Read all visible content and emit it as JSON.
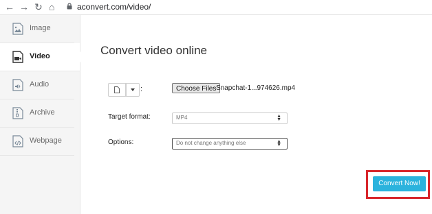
{
  "browser": {
    "url": "aconvert.com/video/",
    "back_glyph": "←",
    "forward_glyph": "→",
    "reload_glyph": "↻",
    "home_glyph": "⌂"
  },
  "sidebar": {
    "items": [
      {
        "label": "Image",
        "icon": "image-file-icon"
      },
      {
        "label": "Video",
        "icon": "video-file-icon",
        "active": true
      },
      {
        "label": "Audio",
        "icon": "audio-file-icon"
      },
      {
        "label": "Archive",
        "icon": "archive-file-icon"
      },
      {
        "label": "Webpage",
        "icon": "webpage-file-icon"
      }
    ]
  },
  "main": {
    "title": "Convert video online",
    "file": {
      "colon": ":",
      "choose_label": "Choose Files",
      "filename": "Snapchat-1...974626.mp4"
    },
    "target_format": {
      "label": "Target format:",
      "value": "MP4"
    },
    "options": {
      "label": "Options:",
      "value": "Do not change anything else"
    },
    "convert_label": "Convert Now!"
  },
  "colors": {
    "accent": "#2bb3dd",
    "highlight": "#d8262b",
    "sidebar_bg": "#f5f5f5"
  }
}
